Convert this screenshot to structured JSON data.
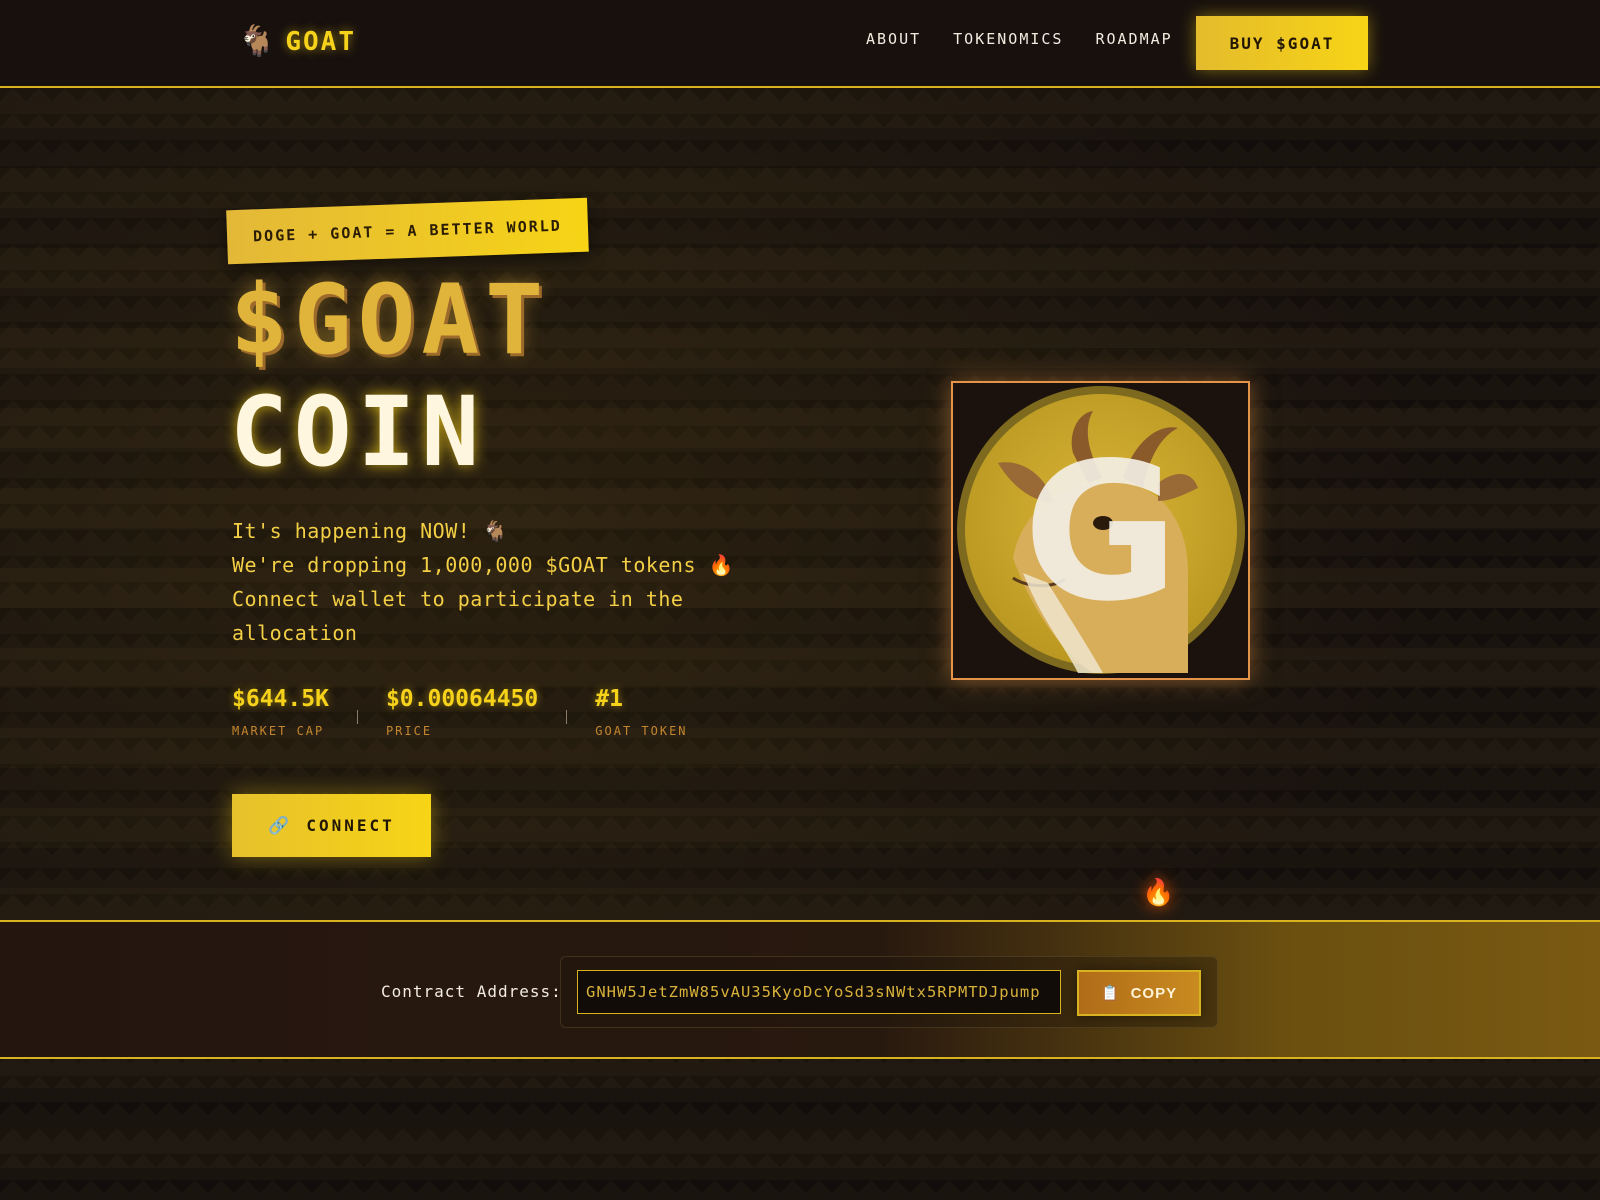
{
  "header": {
    "logo_text": "GOAT",
    "logo_icon": "goat-emoji",
    "nav": [
      {
        "label": "ABOUT"
      },
      {
        "label": "TOKENOMICS"
      },
      {
        "label": "ROADMAP"
      }
    ],
    "buy_label": "BUY $GOAT"
  },
  "hero": {
    "tagline": "DOGE + GOAT = A BETTER WORLD",
    "title_line1": "$GOAT",
    "title_line2": "COIN",
    "desc_lines": [
      "It's happening NOW! 🐐",
      "We're dropping 1,000,000 $GOAT tokens 🔥",
      "Connect wallet to participate in the allocation"
    ],
    "stats": [
      {
        "value": "$644.5K",
        "label": "MARKET CAP"
      },
      {
        "value": "$0.00064450",
        "label": "PRICE"
      },
      {
        "value": "#1",
        "label": "GOAT TOKEN"
      }
    ],
    "connect_label": "CONNECT",
    "connect_icon": "link-icon",
    "coin_letter": "G"
  },
  "contract": {
    "label": "Contract Address:",
    "address": "GNHW5JetZmW85vAU35KyoDcYoSd3sNWtx5RPMTDJpump",
    "copy_label": "COPY",
    "copy_icon": "clipboard-icon"
  },
  "colors": {
    "accent": "#f6d21a",
    "background": "#17110d",
    "orange": "#e39448"
  }
}
